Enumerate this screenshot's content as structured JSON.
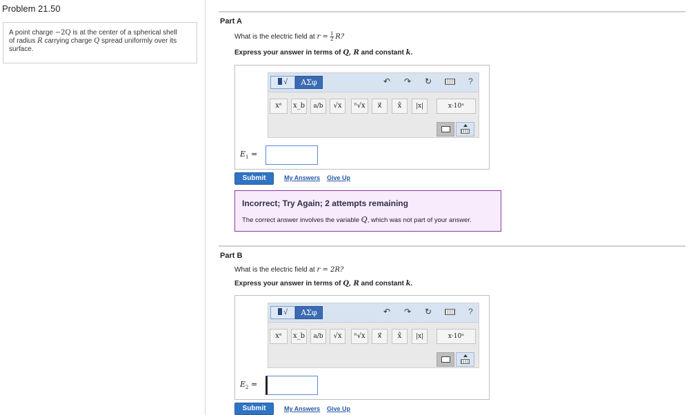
{
  "problem": {
    "title": "Problem 21.50",
    "text_1": "A point charge ",
    "charge": "−2Q",
    "text_2": " is at the center of a spherical shell",
    "text_3": "of radius ",
    "radius": "R",
    "text_4": " carrying charge ",
    "shell_charge": "Q",
    "text_5": " spread uniformly over its",
    "text_6": "surface."
  },
  "toolbar": {
    "template_label": "√",
    "greek_label": "ΑΣφ",
    "undo_icon": "undo-icon",
    "redo_icon": "redo-icon",
    "reset_icon": "reset-icon",
    "keyboard_icon": "keyboard-icon",
    "help_label": "?",
    "symbols": [
      "xᵃ",
      "x_b",
      "a/b",
      "√x",
      "ⁿ√x",
      "x⃗",
      "x̂",
      "|x|",
      "x·10ⁿ"
    ]
  },
  "colors": {
    "submit": "#2f73c4",
    "feedback_border": "#8a3aa6",
    "feedback_bg": "#f7ebfc",
    "link": "#2759a8"
  },
  "part_a": {
    "title": "Part A",
    "question_prefix": "What is the electric field at ",
    "question_var": "r",
    "question_eq": " = ",
    "question_frac_num": "1",
    "question_frac_den": "2",
    "question_tail": "R?",
    "express_prefix": "Express your answer in terms of ",
    "express_vars": "Q, R",
    "express_mid": " and constant ",
    "express_const": "k",
    "express_end": ".",
    "answer_label": "E",
    "answer_sub": "1",
    "answer_eq": " =",
    "answer_value": "",
    "submit_label": "Submit",
    "my_answers_label": "My Answers",
    "give_up_label": "Give Up",
    "feedback_title": "Incorrect; Try Again; 2 attempts remaining",
    "feedback_text_prefix": "The correct answer involves the variable ",
    "feedback_var": "Q",
    "feedback_text_suffix": ", which was not part of your answer."
  },
  "part_b": {
    "title": "Part B",
    "question_prefix": "What is the electric field at ",
    "question_var": "r",
    "question_eq": " = ",
    "question_tail": "2R?",
    "express_prefix": "Express your answer in terms of ",
    "express_vars": "Q, R",
    "express_mid": " and constant ",
    "express_const": "k",
    "express_end": ".",
    "answer_label": "E",
    "answer_sub": "2",
    "answer_eq": " =",
    "answer_value": "",
    "submit_label": "Submit",
    "my_answers_label": "My Answers",
    "give_up_label": "Give Up"
  }
}
